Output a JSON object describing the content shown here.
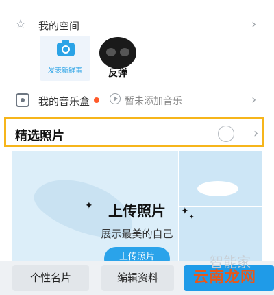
{
  "space": {
    "label": "我的空间",
    "post_tile_label": "发表新鲜事",
    "meme_caption": "反弹"
  },
  "music": {
    "label": "我的音乐盒",
    "status": "暂未添加音乐"
  },
  "photos": {
    "label": "精选照片"
  },
  "banner": {
    "title": "上传照片",
    "subtitle": "展示最美的自己",
    "button_label": "上传照片"
  },
  "bottom": {
    "card_label": "个性名片",
    "edit_label": "编辑资料"
  },
  "watermark": {
    "text": "云南龙网",
    "faint": "智能家"
  },
  "colors": {
    "accent": "#2aa3ea",
    "highlight_border": "#f6b51b",
    "badge": "#ff5a2a"
  },
  "icons": [
    "star-icon",
    "camera-icon",
    "music-box-icon",
    "play-icon",
    "chevron-right-icon",
    "radio-icon"
  ]
}
